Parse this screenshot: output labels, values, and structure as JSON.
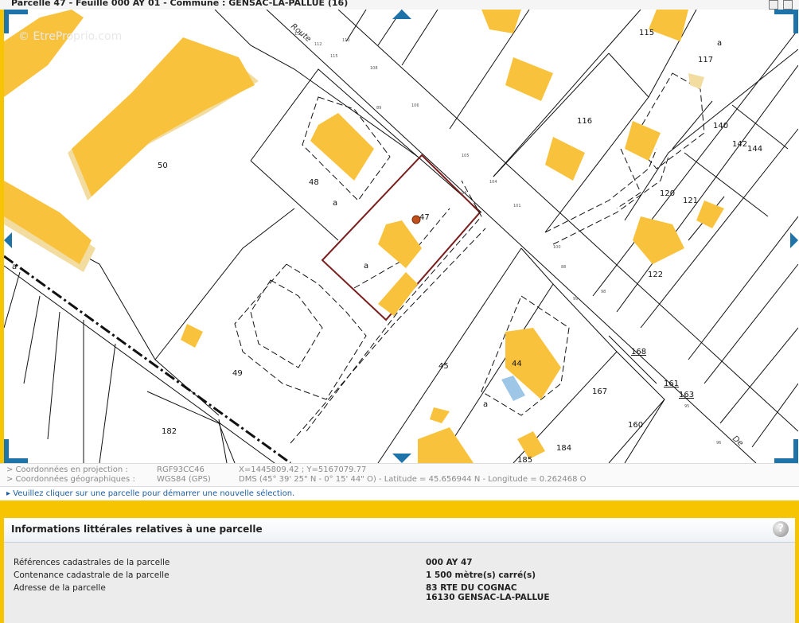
{
  "window": {
    "title": "Parcelle 47 - Feuille 000 AY 01 - Commune : GENSAC-LA-PALLUE (16)"
  },
  "map": {
    "watermark": "© EtreProprio.com",
    "selected_parcel": "47",
    "parcel_numbers": [
      "50",
      "48",
      "47",
      "49",
      "45",
      "44",
      "182",
      "185",
      "184",
      "167",
      "160",
      "168",
      "161",
      "163",
      "122",
      "121",
      "120",
      "140",
      "142",
      "144",
      "116",
      "117",
      "115"
    ],
    "parcel_letters": [
      "a",
      "a",
      "a",
      "a",
      "a"
    ],
    "road_labels": [
      "Route",
      "De"
    ],
    "road_numbers": [
      "108",
      "105",
      "106",
      "104",
      "101",
      "100",
      "99",
      "98",
      "96",
      "94",
      "95",
      "89",
      "110",
      "111",
      "112",
      "115",
      "88"
    ],
    "colors": {
      "building": "#f9c23c",
      "building_shadow": "#f2dca0",
      "selected_outline": "#7a1e1e",
      "parcel_line": "#111111",
      "blue_building": "#9ec6e6",
      "frame_yellow": "#f6c400",
      "nav_arrow": "#1e73a8"
    }
  },
  "coords": {
    "proj_label": "> Coordonnées en projection :",
    "proj_system": "RGF93CC46",
    "proj_value": "X=1445809.42 ; Y=5167079.77",
    "geo_label": "> Coordonnées géographiques :",
    "geo_system": "WGS84 (GPS)",
    "geo_value": "DMS (45° 39' 25\" N - 0° 15' 44\" O) - Latitude = 45.656944 N - Longitude = 0.262468 O"
  },
  "hint": "▸ Veuillez cliquer sur une parcelle pour démarrer une nouvelle sélection.",
  "info": {
    "title": "Informations littérales relatives à une parcelle",
    "help": "?",
    "rows": [
      {
        "label": "Références cadastrales de la parcelle",
        "value": "000 AY 47"
      },
      {
        "label": "Contenance cadastrale de la parcelle",
        "value": "1 500 mètre(s) carré(s)"
      },
      {
        "label": "Adresse de la parcelle",
        "value": "83 RTE DU COGNAC",
        "value2": "16130 GENSAC-LA-PALLUE"
      }
    ]
  }
}
